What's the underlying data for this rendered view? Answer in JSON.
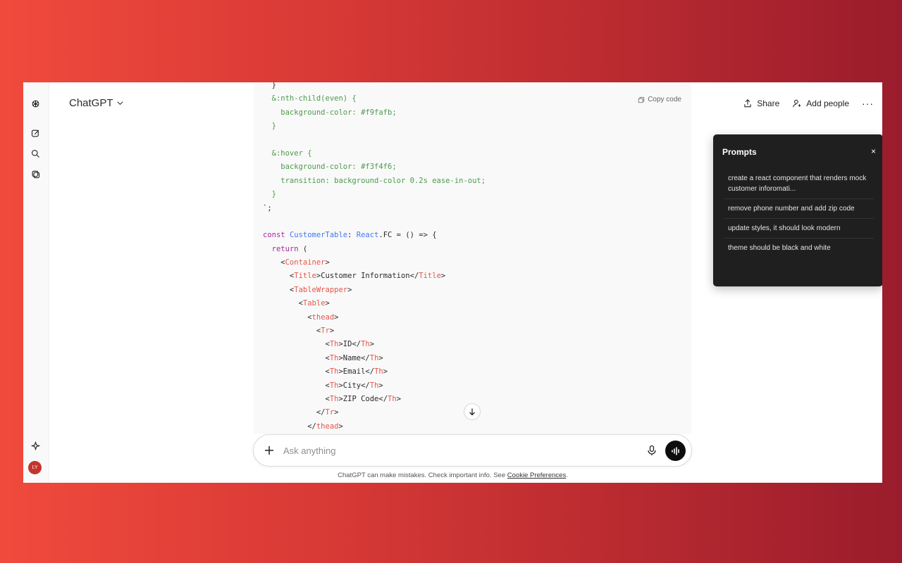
{
  "header": {
    "model_label": "ChatGPT",
    "share_label": "Share",
    "add_people_label": "Add people",
    "more_label": "···"
  },
  "user": {
    "initials": "LY"
  },
  "code_block": {
    "copy_label": "Copy code",
    "lines": [
      [
        {
          "t": "  }",
          "c": "t-plain"
        }
      ],
      [
        {
          "t": "  &:nth-child(even) {",
          "c": "t-str"
        }
      ],
      [
        {
          "t": "    background-color: #f9fafb;",
          "c": "t-str"
        }
      ],
      [
        {
          "t": "  }",
          "c": "t-str"
        }
      ],
      [
        {
          "t": "",
          "c": "t-plain"
        }
      ],
      [
        {
          "t": "  &:hover {",
          "c": "t-str"
        }
      ],
      [
        {
          "t": "    background-color: #f3f4f6;",
          "c": "t-str"
        }
      ],
      [
        {
          "t": "    transition: background-color 0.2s ease-in-out;",
          "c": "t-str"
        }
      ],
      [
        {
          "t": "  }",
          "c": "t-str"
        }
      ],
      [
        {
          "t": "`;",
          "c": "t-plain"
        }
      ],
      [
        {
          "t": "",
          "c": "t-plain"
        }
      ],
      [
        {
          "t": "const ",
          "c": "t-kw"
        },
        {
          "t": "CustomerTable",
          "c": "t-fn"
        },
        {
          "t": ": ",
          "c": "t-plain"
        },
        {
          "t": "React",
          "c": "t-fn"
        },
        {
          "t": ".FC = () => {",
          "c": "t-plain"
        }
      ],
      [
        {
          "t": "  return",
          "c": "t-kw"
        },
        {
          "t": " (",
          "c": "t-plain"
        }
      ],
      [
        {
          "t": "    <",
          "c": "t-plain"
        },
        {
          "t": "Container",
          "c": "t-tag"
        },
        {
          "t": ">",
          "c": "t-plain"
        }
      ],
      [
        {
          "t": "      <",
          "c": "t-plain"
        },
        {
          "t": "Title",
          "c": "t-tag"
        },
        {
          "t": ">Customer Information</",
          "c": "t-plain"
        },
        {
          "t": "Title",
          "c": "t-tag"
        },
        {
          "t": ">",
          "c": "t-plain"
        }
      ],
      [
        {
          "t": "      <",
          "c": "t-plain"
        },
        {
          "t": "TableWrapper",
          "c": "t-tag"
        },
        {
          "t": ">",
          "c": "t-plain"
        }
      ],
      [
        {
          "t": "        <",
          "c": "t-plain"
        },
        {
          "t": "Table",
          "c": "t-tag"
        },
        {
          "t": ">",
          "c": "t-plain"
        }
      ],
      [
        {
          "t": "          <",
          "c": "t-plain"
        },
        {
          "t": "thead",
          "c": "t-tag"
        },
        {
          "t": ">",
          "c": "t-plain"
        }
      ],
      [
        {
          "t": "            <",
          "c": "t-plain"
        },
        {
          "t": "Tr",
          "c": "t-tag"
        },
        {
          "t": ">",
          "c": "t-plain"
        }
      ],
      [
        {
          "t": "              <",
          "c": "t-plain"
        },
        {
          "t": "Th",
          "c": "t-tag"
        },
        {
          "t": ">ID</",
          "c": "t-plain"
        },
        {
          "t": "Th",
          "c": "t-tag"
        },
        {
          "t": ">",
          "c": "t-plain"
        }
      ],
      [
        {
          "t": "              <",
          "c": "t-plain"
        },
        {
          "t": "Th",
          "c": "t-tag"
        },
        {
          "t": ">Name</",
          "c": "t-plain"
        },
        {
          "t": "Th",
          "c": "t-tag"
        },
        {
          "t": ">",
          "c": "t-plain"
        }
      ],
      [
        {
          "t": "              <",
          "c": "t-plain"
        },
        {
          "t": "Th",
          "c": "t-tag"
        },
        {
          "t": ">Email</",
          "c": "t-plain"
        },
        {
          "t": "Th",
          "c": "t-tag"
        },
        {
          "t": ">",
          "c": "t-plain"
        }
      ],
      [
        {
          "t": "              <",
          "c": "t-plain"
        },
        {
          "t": "Th",
          "c": "t-tag"
        },
        {
          "t": ">City</",
          "c": "t-plain"
        },
        {
          "t": "Th",
          "c": "t-tag"
        },
        {
          "t": ">",
          "c": "t-plain"
        }
      ],
      [
        {
          "t": "              <",
          "c": "t-plain"
        },
        {
          "t": "Th",
          "c": "t-tag"
        },
        {
          "t": ">ZIP Code</",
          "c": "t-plain"
        },
        {
          "t": "Th",
          "c": "t-tag"
        },
        {
          "t": ">",
          "c": "t-plain"
        }
      ],
      [
        {
          "t": "            </",
          "c": "t-plain"
        },
        {
          "t": "Tr",
          "c": "t-tag"
        },
        {
          "t": ">",
          "c": "t-plain"
        }
      ],
      [
        {
          "t": "          </",
          "c": "t-plain"
        },
        {
          "t": "thead",
          "c": "t-tag"
        },
        {
          "t": ">",
          "c": "t-plain"
        }
      ]
    ]
  },
  "composer": {
    "placeholder": "Ask anything"
  },
  "footer": {
    "note": "ChatGPT can make mistakes. Check important info. See ",
    "link": "Cookie Preferences",
    "end": "."
  },
  "prompts_panel": {
    "title": "Prompts",
    "close": "×",
    "items": [
      "create a react component that renders mock customer inforomati...",
      "remove phone number and add zip code",
      "update styles, it should look modern",
      "theme should be black and white"
    ]
  }
}
